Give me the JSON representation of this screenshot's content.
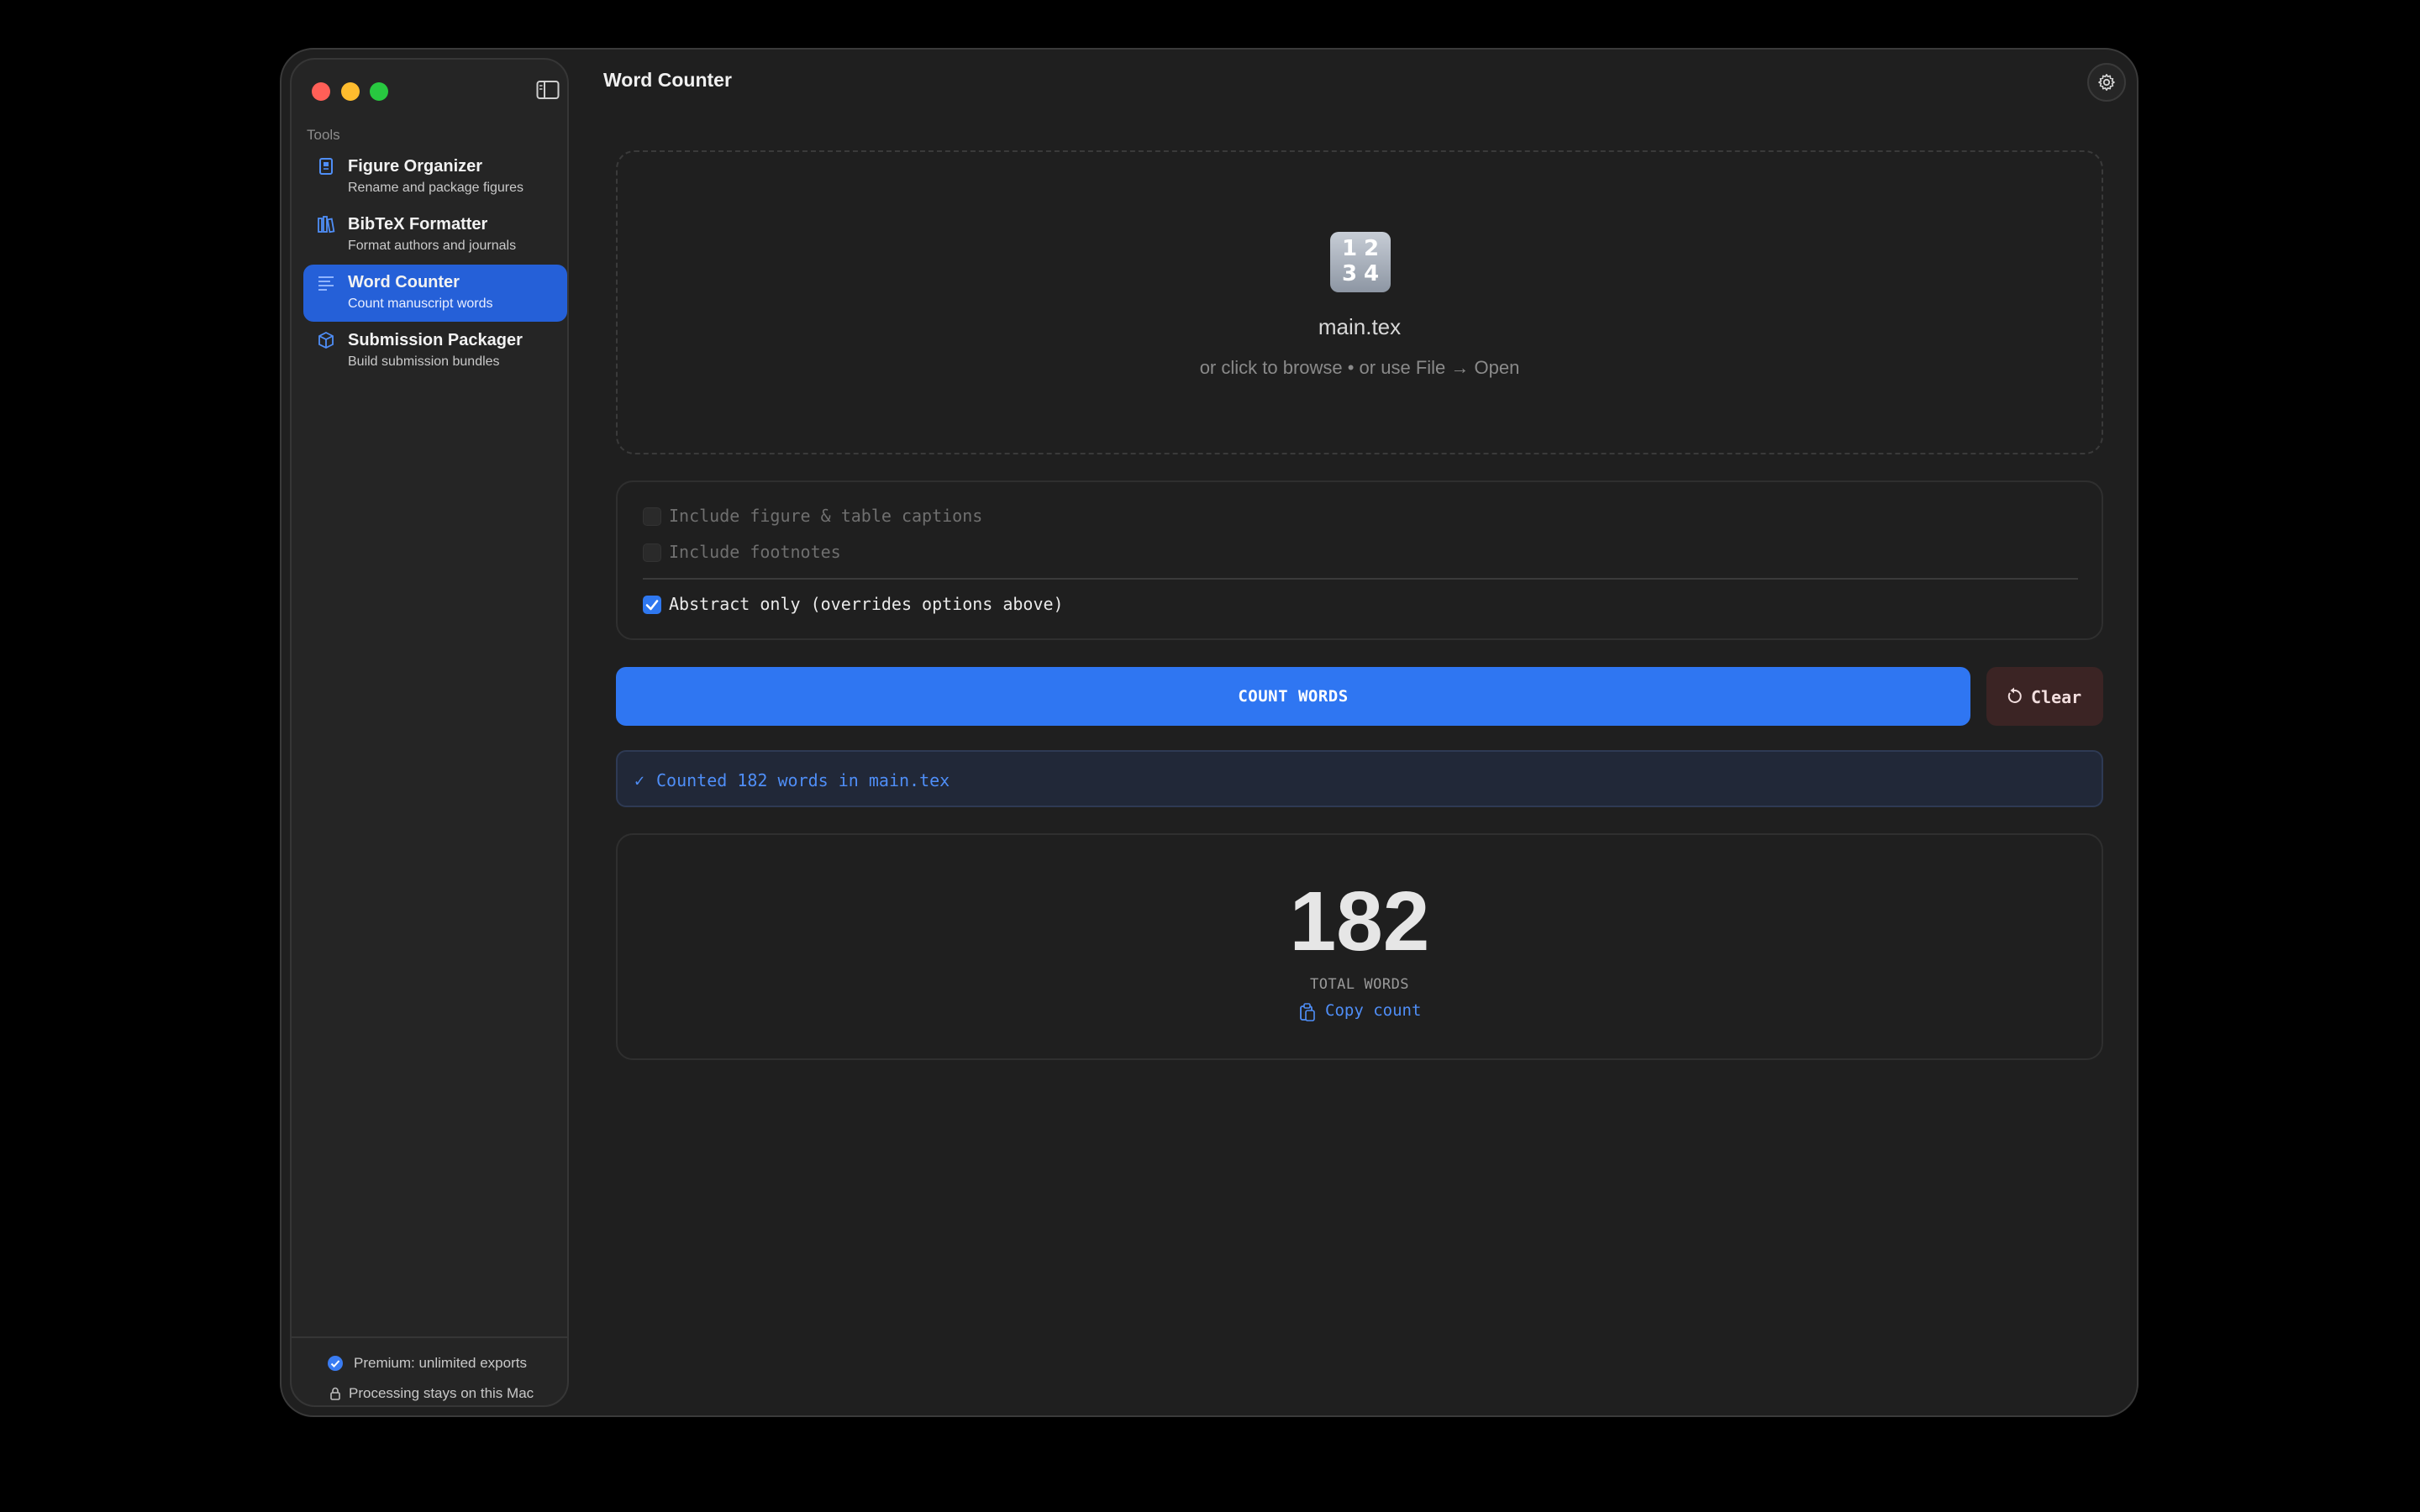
{
  "window": {
    "title": "Word Counter"
  },
  "sidebar": {
    "section_label": "Tools",
    "items": [
      {
        "title": "Figure Organizer",
        "subtitle": "Rename and package figures",
        "icon": "figure-doc-icon",
        "active": false
      },
      {
        "title": "BibTeX Formatter",
        "subtitle": "Format authors and journals",
        "icon": "books-icon",
        "active": false
      },
      {
        "title": "Word Counter",
        "subtitle": "Count manuscript words",
        "icon": "text-lines-icon",
        "active": true
      },
      {
        "title": "Submission Packager",
        "subtitle": "Build submission bundles",
        "icon": "package-cube-icon",
        "active": false
      }
    ],
    "footer": {
      "premium": "Premium: unlimited exports",
      "privacy": "Processing stays on this Mac"
    }
  },
  "dropzone": {
    "icon_digits": [
      "1",
      "2",
      "3",
      "4"
    ],
    "file_name": "main.tex",
    "hint": "or click to browse • or use File → Open"
  },
  "options": {
    "captions": {
      "label": "Include figure & table captions",
      "checked": false,
      "enabled": false
    },
    "footnotes": {
      "label": "Include footnotes",
      "checked": false,
      "enabled": false
    },
    "abstract": {
      "label": "Abstract only (overrides options above)",
      "checked": true,
      "enabled": true
    }
  },
  "actions": {
    "count_label": "COUNT WORDS",
    "clear_label": "Clear"
  },
  "status": {
    "check": "✓",
    "message": "Counted 182 words in main.tex"
  },
  "result": {
    "count": "182",
    "label": "TOTAL WORDS",
    "copy_label": "Copy count"
  },
  "colors": {
    "accent": "#2f76f2",
    "sidebar_active": "#2560d8",
    "status_text": "#4f8ef7",
    "clear_bg": "#3b2424"
  }
}
